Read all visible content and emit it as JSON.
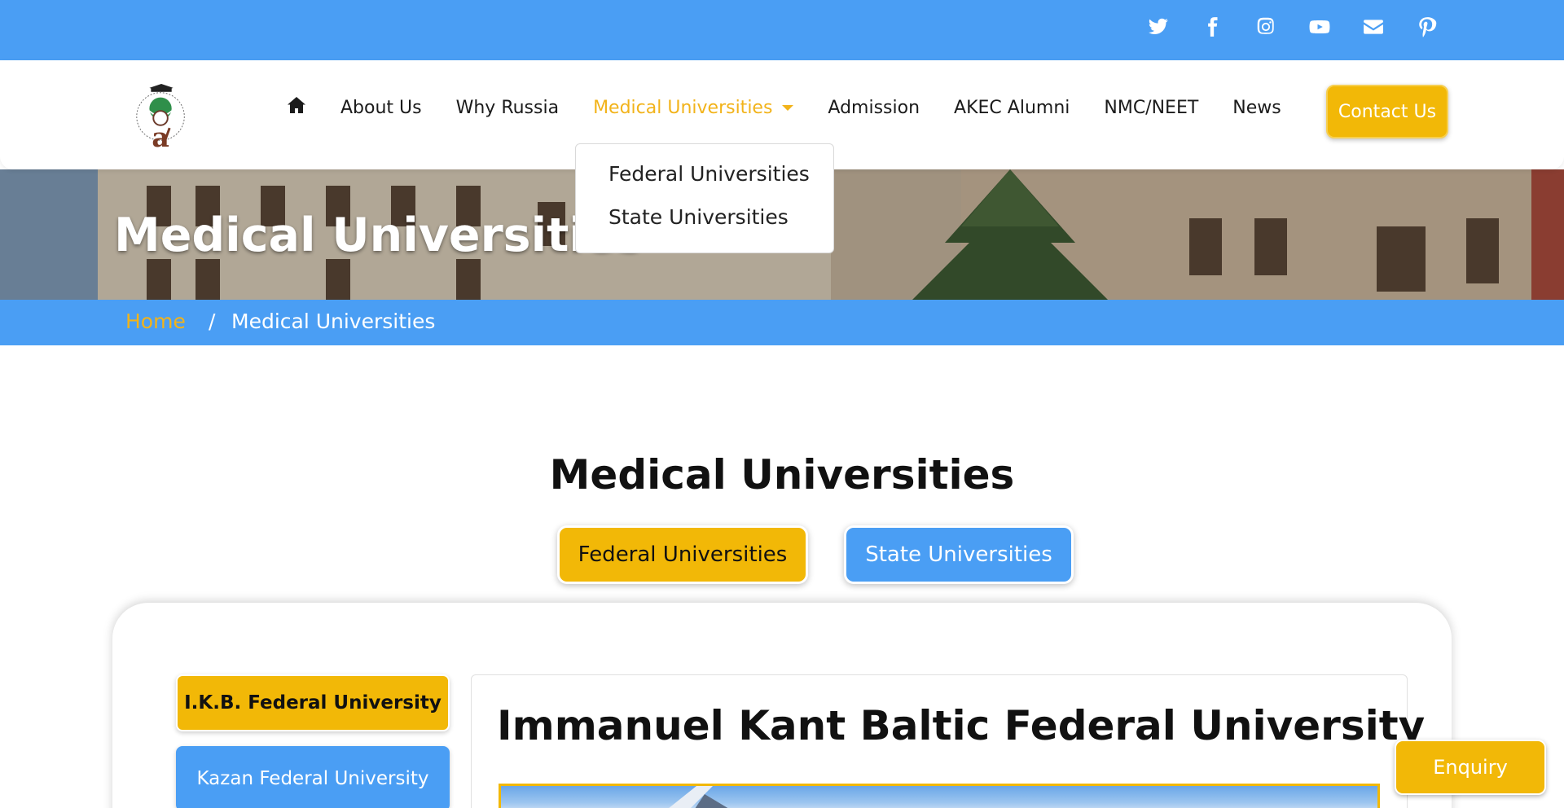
{
  "social": {
    "icons": [
      "twitter-icon",
      "facebook-icon",
      "instagram-icon",
      "youtube-icon",
      "envelope-icon",
      "pinterest-icon"
    ]
  },
  "nav": {
    "items": [
      "About Us",
      "Why Russia",
      "Medical Universities",
      "Admission",
      "AKEC Alumni",
      "NMC/NEET",
      "News"
    ],
    "contact": "Contact Us",
    "active_color": "#f2b31a"
  },
  "dropdown": {
    "items": [
      "Federal Universities",
      "State Universities"
    ]
  },
  "hero": {
    "title": "Medical Universities"
  },
  "breadcrumb": {
    "home": "Home",
    "separator": "/",
    "current": "Medical Universities"
  },
  "section": {
    "title": "Medical Universities",
    "tabs": [
      "Federal Universities",
      "State Universities"
    ]
  },
  "sidebar": {
    "items": [
      "I.K.B. Federal University",
      "Kazan Federal University"
    ]
  },
  "content": {
    "title": "Immanuel Kant Baltic Federal University"
  },
  "enquiry": "Enquiry",
  "colors": {
    "primary_blue": "#4a9ef4",
    "accent_yellow": "#f2b807"
  }
}
